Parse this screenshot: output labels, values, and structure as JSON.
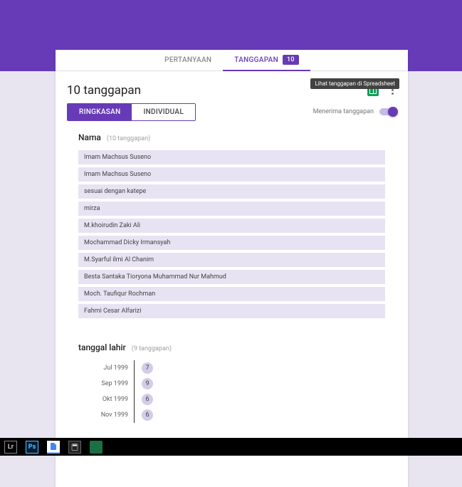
{
  "tabs": {
    "pertanyaan": "PERTANYAAN",
    "tanggapan": "TANGGAPAN",
    "badge": "10"
  },
  "header": {
    "title": "10 tanggapan",
    "tooltip": "Lihat tanggapan di Spreadsheet",
    "receive_label": "Menerima tanggapan"
  },
  "seg": {
    "ringkasan": "RINGKASAN",
    "individual": "INDIVIDUAL"
  },
  "q1": {
    "title": "Nama",
    "count": "(10 tanggapan)",
    "items": [
      "Imam Machsus Suseno",
      "Imam Machsus Suseno",
      "sesuai dengan katepe",
      "mirza",
      "M.khoirudin Zaki Ali",
      "Mochammad Dicky Irmansyah",
      "M.Syarful ilmi Al Chanim",
      "Besta Santaka Tioryona Muhammad Nur Mahmud",
      "Moch. Taufiqur Rochman",
      "Fahmi Cesar Alfarizi"
    ]
  },
  "q2": {
    "title": "tanggal lahir",
    "count": "(9 tanggapan)"
  },
  "chart_data": {
    "type": "bar",
    "categories": [
      "Jul 1999",
      "Sep 1999",
      "Okt 1999",
      "Nov 1999"
    ],
    "values": [
      7,
      9,
      6,
      6
    ],
    "title": "tanggal lahir",
    "xlabel": "",
    "ylabel": "",
    "ylim": [
      0,
      10
    ]
  }
}
